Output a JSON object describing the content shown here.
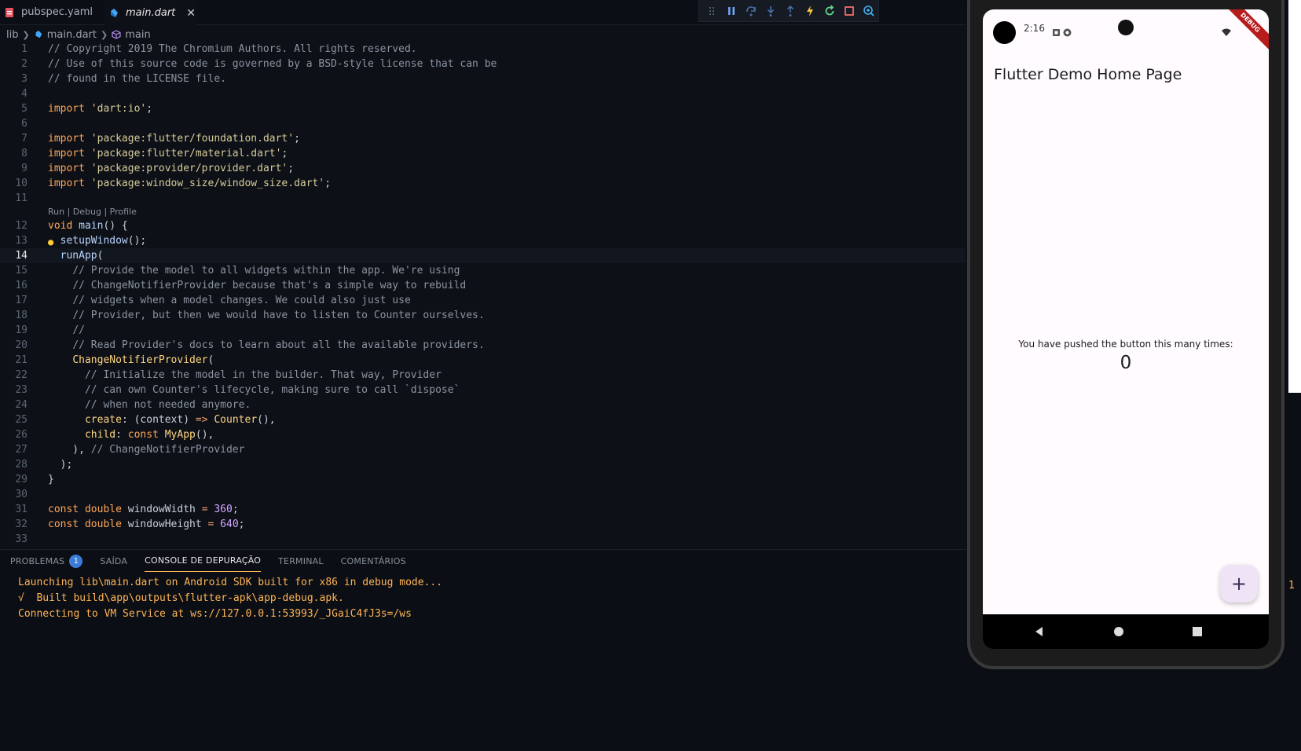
{
  "tabs": [
    {
      "label": "pubspec.yaml"
    },
    {
      "label": "main.dart"
    }
  ],
  "breadcrumb": [
    "lib",
    "main.dart",
    "main"
  ],
  "codelens": "Run | Debug | Profile",
  "code": [
    "// Copyright 2019 The Chromium Authors. All rights reserved.",
    "// Use of this source code is governed by a BSD-style license that can be",
    "// found in the LICENSE file.",
    "",
    "import 'dart:io';",
    "",
    "import 'package:flutter/foundation.dart';",
    "import 'package:flutter/material.dart';",
    "import 'package:provider/provider.dart';",
    "import 'package:window_size/window_size.dart';",
    "",
    "void main() {",
    "  setupWindow();",
    "  runApp(",
    "    // Provide the model to all widgets within the app. We're using",
    "    // ChangeNotifierProvider because that's a simple way to rebuild",
    "    // widgets when a model changes. We could also just use",
    "    // Provider, but then we would have to listen to Counter ourselves.",
    "    //",
    "    // Read Provider's docs to learn about all the available providers.",
    "    ChangeNotifierProvider(",
    "      // Initialize the model in the builder. That way, Provider",
    "      // can own Counter's lifecycle, making sure to call `dispose`",
    "      // when not needed anymore.",
    "      create: (context) => Counter(),",
    "      child: const MyApp(),",
    "    ), // ChangeNotifierProvider",
    "  );",
    "}",
    "",
    "const double windowWidth = 360;",
    "const double windowHeight = 640;",
    ""
  ],
  "current_line": 14,
  "panel": {
    "tabs": [
      "PROBLEMAS",
      "SAÍDA",
      "CONSOLE DE DEPURAÇÃO",
      "TERMINAL",
      "COMENTÁRIOS"
    ],
    "problems_count": "1",
    "console_lines": [
      "Launching lib\\main.dart on Android SDK built for x86 in debug mode...",
      "√  Built build\\app\\outputs\\flutter-apk\\app-debug.apk.",
      "Connecting to VM Service at ws://127.0.0.1:53993/_JGaiC4fJ3s=/ws"
    ]
  },
  "side_number": "1",
  "phone": {
    "time": "2:16",
    "ribbon": "DEBUG",
    "appbar_title": "Flutter Demo Home Page",
    "counter_label": "You have pushed the button this many times:",
    "counter_value": "0",
    "fab_label": "+"
  },
  "colors": {
    "accent": "#ffb454",
    "badge": "#3b7cd9",
    "ribbon": "#b71c1c"
  }
}
